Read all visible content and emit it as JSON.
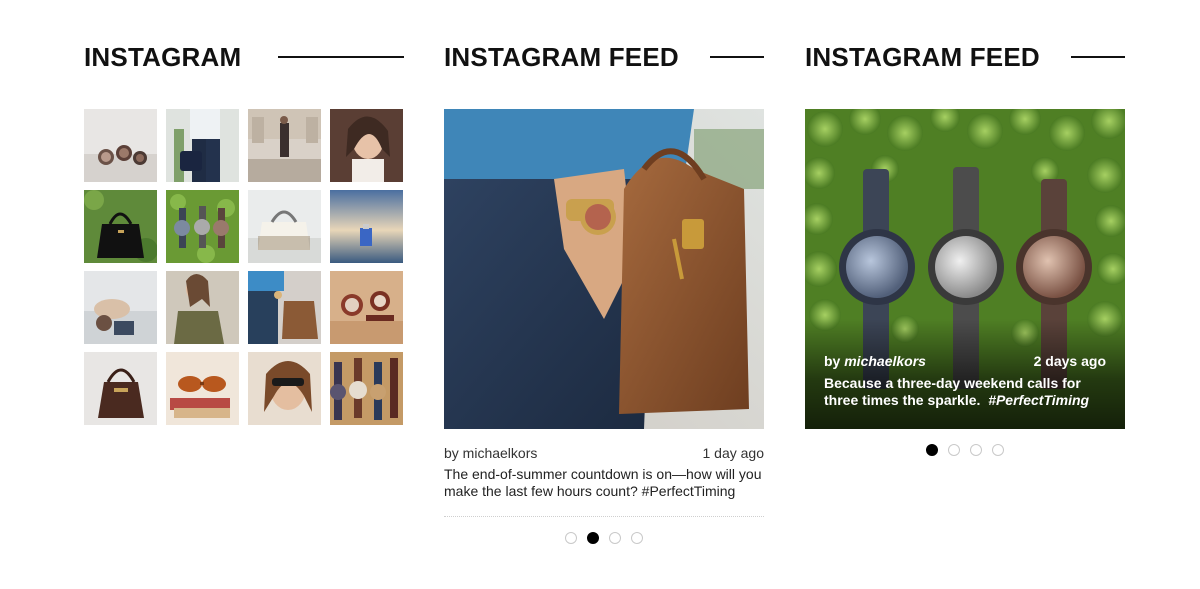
{
  "sections": [
    {
      "title": "INSTAGRAM"
    },
    {
      "title": "INSTAGRAM FEED"
    },
    {
      "title": "INSTAGRAM FEED"
    }
  ],
  "grid": {
    "thumbs": [
      {
        "subject": "watches on table"
      },
      {
        "subject": "person with bag"
      },
      {
        "subject": "woman on steps"
      },
      {
        "subject": "woman portrait"
      },
      {
        "subject": "black handbag"
      },
      {
        "subject": "watches on leaves"
      },
      {
        "subject": "white python bag"
      },
      {
        "subject": "perfume at sunset"
      },
      {
        "subject": "woman lying down"
      },
      {
        "subject": "woman in olive"
      },
      {
        "subject": "arm with brown bag"
      },
      {
        "subject": "watches on wood"
      },
      {
        "subject": "brown bucket bag"
      },
      {
        "subject": "sunglasses on books"
      },
      {
        "subject": "woman in sunglasses"
      },
      {
        "subject": "watches in row"
      }
    ]
  },
  "feed_middle": {
    "user": "by michaelkors",
    "time": "1 day ago",
    "caption": "The end-of-summer countdown is on—how will you make the last few hours count?  #PerfectTiming",
    "active_dot": 1,
    "dot_count": 4
  },
  "feed_right": {
    "by": "by",
    "user": "michaelkors",
    "time": "2 days ago",
    "caption_text": "Because a three-day weekend calls for three times the sparkle.",
    "caption_tag": "#PerfectTiming",
    "active_dot": 0,
    "dot_count": 4
  },
  "colors": {
    "accent": "#000000",
    "text": "#111111",
    "muted": "#333333",
    "dot_border": "#c9c9c9"
  }
}
